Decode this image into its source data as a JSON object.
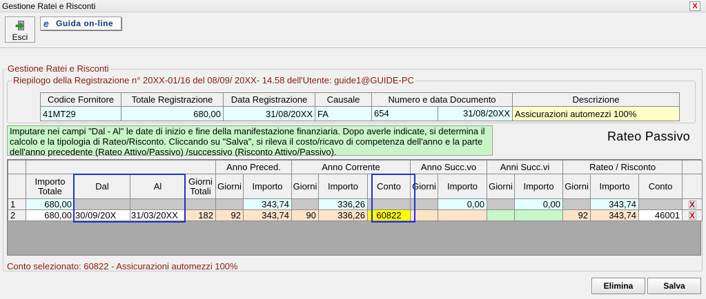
{
  "window": {
    "title": "Gestione Ratei e Risconti",
    "close_label": "X"
  },
  "toolbar": {
    "esci_label": "Esci",
    "guida_label": "Guida on-line",
    "guida_icon": "e"
  },
  "main_group": {
    "label": "Gestione Ratei e Risconti"
  },
  "riepilogo": {
    "label": "Riepilogo della Registrazione n°  20XX-01/16  del 08/09/ 20XX- 14.58 dell'Utente: guide1@GUIDE-PC",
    "headers": [
      "Codice Fornitore",
      "Totale Registrazione",
      "Data Registrazione",
      "Causale",
      "Numero e data Documento",
      "Descrizione"
    ],
    "values": {
      "codice_fornitore": "41MT29",
      "totale": "680,00",
      "data": "31/08/20XX",
      "causale": "FA",
      "numero": "654",
      "data_documento": "31/08/20XX",
      "descrizione": "Assicurazioni automezzi 100%"
    }
  },
  "info_text": "Imputare nei campi \"Dal - Al\" le date di inizio e fine della manifestazione finanziaria. Dopo averle indicate, si determina il calcolo e la tipologia di Rateo/Risconto. Cliccando su \"Salva\", si rileva il costo/ricavo di competenza dell'anno e la parte dell'anno precedente (Rateo Attivo/Passivo) /successivo (Risconto Attivo/Passivo).",
  "rateo_title": "Rateo Passivo",
  "grid": {
    "groups": {
      "anno_preced": "Anno Preced.",
      "anno_corrente": "Anno Corrente",
      "anno_succ": "Anno Succ.vo",
      "anni_succ": "Anni Succ.vi",
      "rateo_risconto": "Rateo / Risconto"
    },
    "columns": {
      "importo_totale": "Importo Totale",
      "dal": "Dal",
      "al": "Al",
      "giorni_totali": "Giorni Totali",
      "giorni": "Giorni",
      "importo": "Importo",
      "conto": "Conto"
    },
    "rows": [
      {
        "num": "1",
        "importo_totale": "680,00",
        "dal": "",
        "al": "",
        "giorni_totali": "",
        "prec_giorni": "",
        "prec_importo": "343,74",
        "corr_giorni": "",
        "corr_importo": "336,26",
        "corr_conto": "",
        "succ_giorni": "",
        "succ_importo": "0,00",
        "succvi_giorni": "",
        "succvi_importo": "0,00",
        "rr_giorni": "",
        "rr_importo": "343,74",
        "rr_conto": "",
        "delete": "X"
      },
      {
        "num": "2",
        "importo_totale": "680,00",
        "dal": "30/09/20X",
        "al": "31/03/20XX",
        "giorni_totali": "182",
        "prec_giorni": "92",
        "prec_importo": "343,74",
        "corr_giorni": "90",
        "corr_importo": "336,26",
        "corr_conto": "60822",
        "succ_giorni": "",
        "succ_importo": "",
        "succvi_giorni": "",
        "succvi_importo": "",
        "rr_giorni": "92",
        "rr_importo": "343,74",
        "rr_conto": "46001",
        "delete": "X"
      }
    ]
  },
  "status_text": "Conto selezionato: 60822 - Assicurazioni automezzi 100%",
  "buttons": {
    "elimina": "Elimina",
    "salva": "Salva"
  }
}
